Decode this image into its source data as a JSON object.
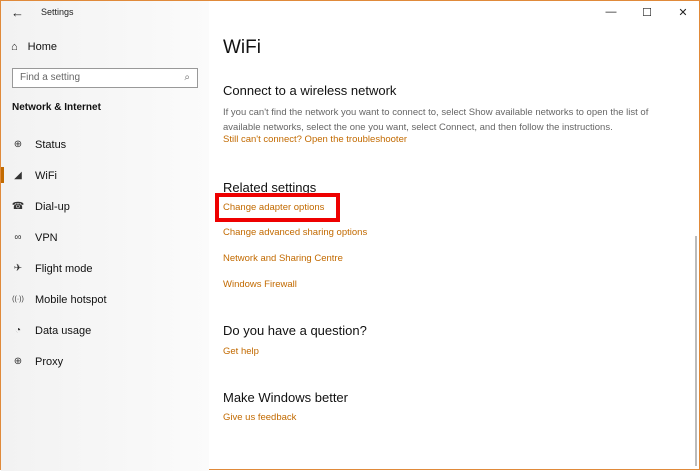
{
  "window": {
    "title": "Settings",
    "back": "←",
    "minimize": "—",
    "maximize": "☐",
    "close": "✕"
  },
  "sidebar": {
    "home": "Home",
    "search_placeholder": "Find a setting",
    "section": "Network & Internet",
    "items": [
      {
        "label": "Status",
        "icon": "⊕"
      },
      {
        "label": "WiFi",
        "icon": "◢"
      },
      {
        "label": "Dial-up",
        "icon": "☎"
      },
      {
        "label": "VPN",
        "icon": "∞"
      },
      {
        "label": "Flight mode",
        "icon": "✈"
      },
      {
        "label": "Mobile hotspot",
        "icon": "((·))"
      },
      {
        "label": "Data usage",
        "icon": "◔"
      },
      {
        "label": "Proxy",
        "icon": "⊕"
      }
    ]
  },
  "main": {
    "title": "WiFi",
    "connect_heading": "Connect to a wireless network",
    "connect_text": "If you can't find the network you want to connect to, select Show available networks to open the list of available networks, select the one you want, select Connect, and then follow the instructions.",
    "troubleshooter": "Still can't connect? Open the troubleshooter",
    "related_heading": "Related settings",
    "related_links": [
      "Change adapter options",
      "Change advanced sharing options",
      "Network and Sharing Centre",
      "Windows Firewall"
    ],
    "question_heading": "Do you have a question?",
    "get_help": "Get help",
    "better_heading": "Make Windows better",
    "feedback": "Give us feedback"
  },
  "colors": {
    "accent": "#c26a00",
    "highlight": "#e00000"
  }
}
